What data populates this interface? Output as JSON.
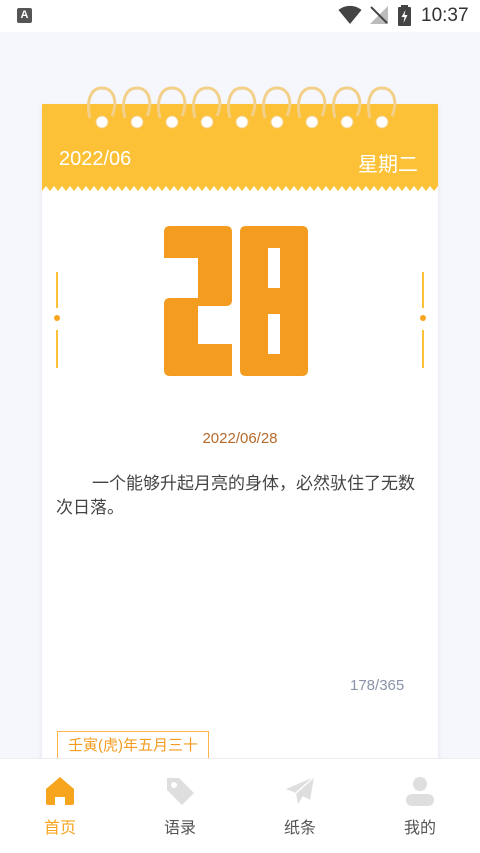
{
  "status_bar": {
    "left_icon": "A",
    "time": "10:37"
  },
  "calendar": {
    "header_date": "2022/06",
    "weekday": "星期二",
    "day": "28",
    "full_date": "2022/06/28",
    "quote": "一个能够升起月亮的身体，必然驮住了无数次日落。",
    "day_count": "178/365",
    "lunar": "壬寅(虎)年五月三十"
  },
  "tabs": [
    {
      "label": "首页",
      "icon": "home-icon",
      "active": true
    },
    {
      "label": "语录",
      "icon": "tag-icon",
      "active": false
    },
    {
      "label": "纸条",
      "icon": "paper-plane-icon",
      "active": false
    },
    {
      "label": "我的",
      "icon": "user-icon",
      "active": false
    }
  ],
  "colors": {
    "accent": "#fcc137",
    "active_tab": "#f7a51f",
    "day_number": "#f39c20"
  }
}
